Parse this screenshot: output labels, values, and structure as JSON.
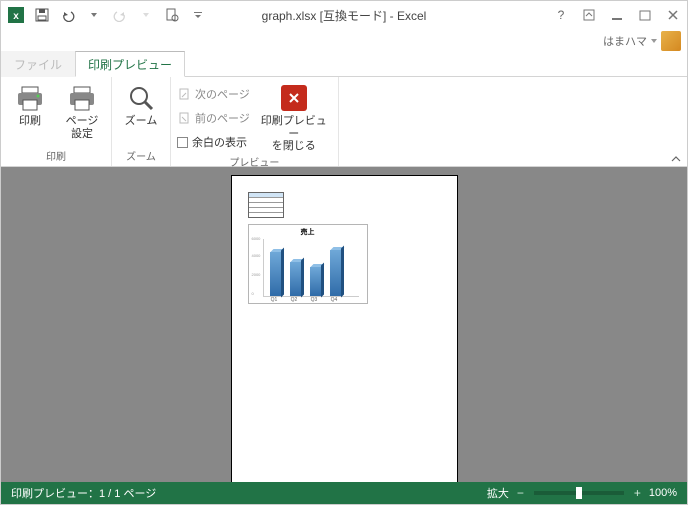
{
  "title": "graph.xlsx  [互換モード] - Excel",
  "user": {
    "name": "はまハマ"
  },
  "tabs": {
    "file": "ファイル",
    "preview": "印刷プレビュー"
  },
  "ribbon": {
    "print": {
      "label": "印刷",
      "print_btn": "印刷",
      "page_setup": "ページ\n設定"
    },
    "zoom": {
      "label": "ズーム",
      "zoom_btn": "ズーム"
    },
    "preview": {
      "label": "プレビュー",
      "next": "次のページ",
      "prev": "前のページ",
      "margins": "余白の表示",
      "close": "印刷プレビュー\nを閉じる"
    }
  },
  "status": {
    "left": "印刷プレビュー：1 / 1 ページ",
    "zoom_label": "拡大",
    "zoom_pct": "100%"
  },
  "chart_data": {
    "type": "bar",
    "title": "売上",
    "categories": [
      "Q1",
      "Q2",
      "Q3",
      "Q4"
    ],
    "values": [
      4900,
      3800,
      3200,
      5100
    ],
    "ylim": [
      0,
      6000
    ],
    "ytick": [
      "0",
      "2000",
      "4000",
      "6000"
    ],
    "xlabel": "",
    "ylabel": ""
  }
}
